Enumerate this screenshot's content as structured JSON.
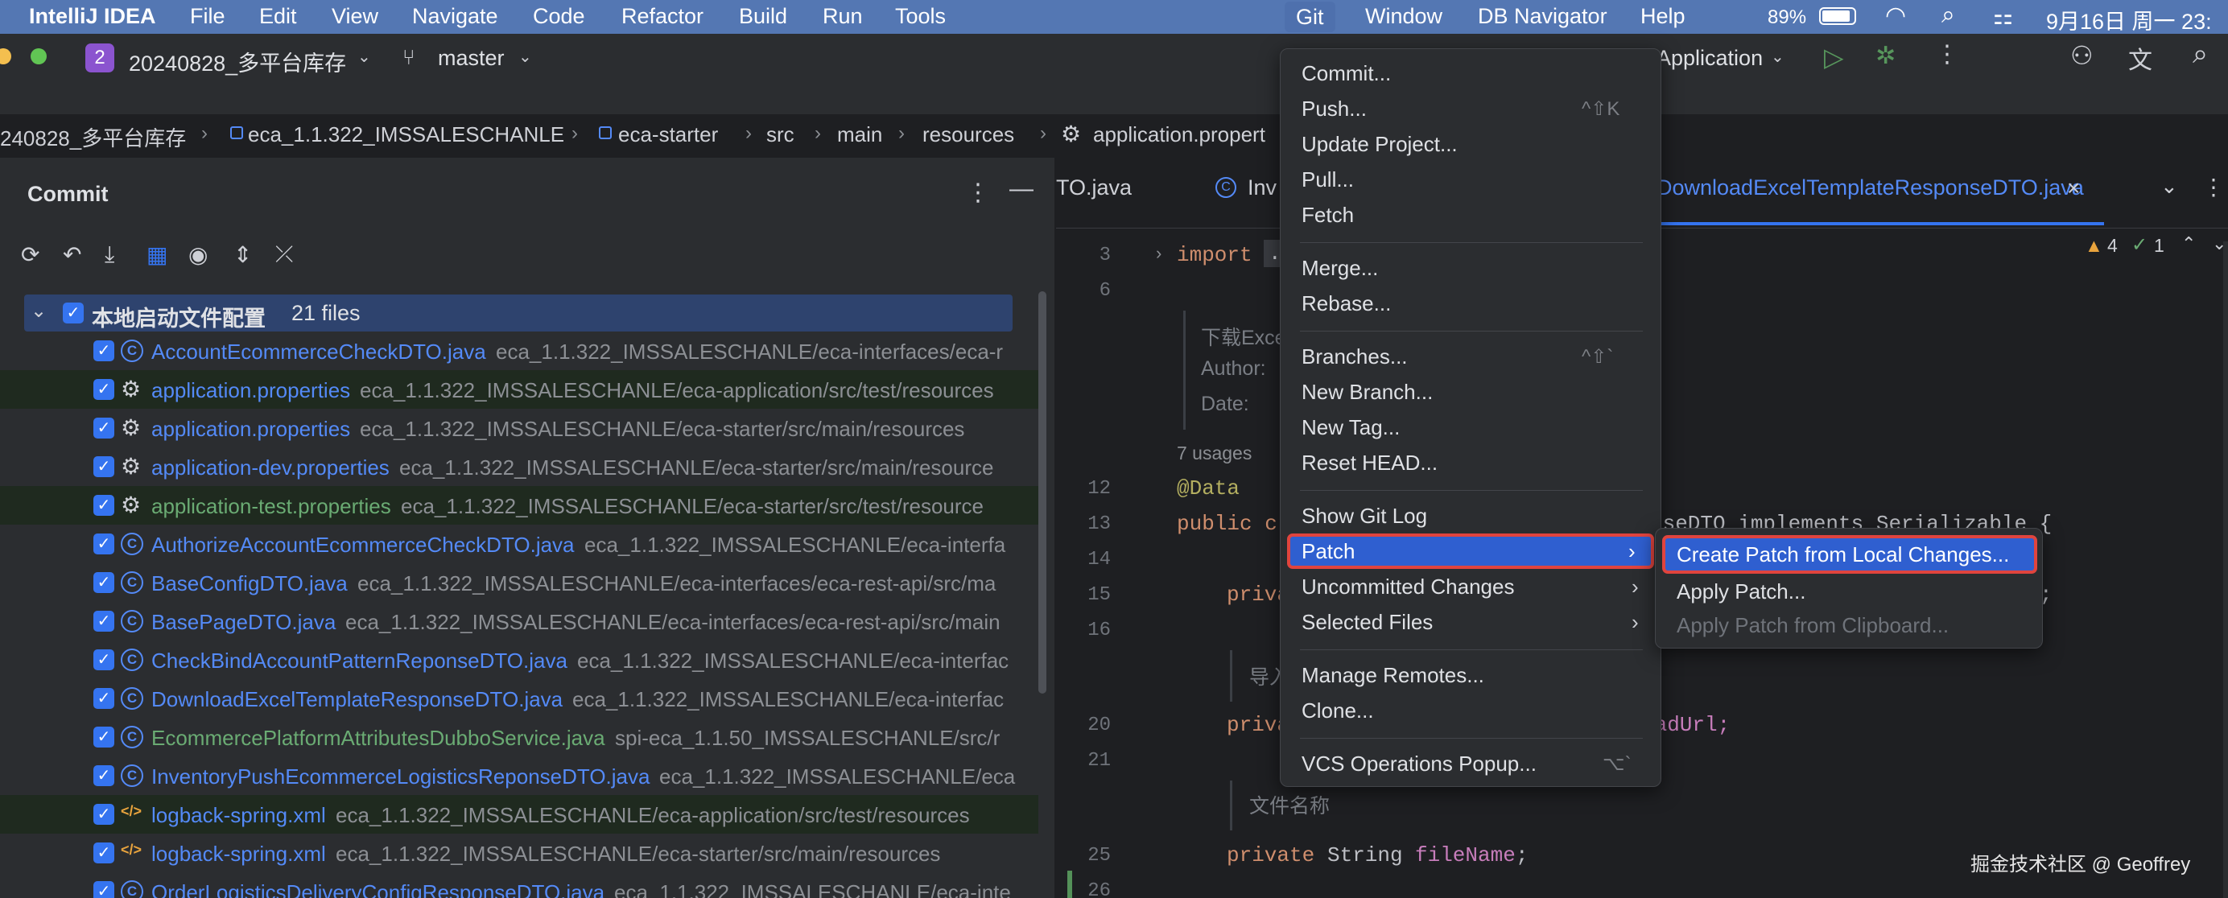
{
  "menubar": {
    "app": "IntelliJ IDEA",
    "items": [
      "File",
      "Edit",
      "View",
      "Navigate",
      "Code",
      "Refactor",
      "Build",
      "Run",
      "Tools",
      "Git",
      "Window",
      "DB Navigator",
      "Help"
    ],
    "battery": "89%",
    "datetime": "9月16日 周一 23:"
  },
  "toolbar": {
    "project_badge": "2",
    "project": "20240828_多平台库存",
    "branch": "master",
    "run_config": "Application"
  },
  "breadcrumb": [
    "240828_多平台库存",
    "eca_1.1.322_IMSSALESCHANLE",
    "eca-starter",
    "src",
    "main",
    "resources",
    "application.propert"
  ],
  "commit": {
    "title": "Commit",
    "group_label": "本地启动文件配置",
    "group_count": "21 files",
    "files": [
      {
        "name": "AccountEcommerceCheckDTO.java",
        "path": "eca_1.1.322_IMSSALESCHANLE/eca-interfaces/eca-r",
        "icon": "class",
        "color": "#548af7"
      },
      {
        "name": "application.properties",
        "path": "eca_1.1.322_IMSSALESCHANLE/eca-application/src/test/resources",
        "icon": "gear",
        "color": "#548af7",
        "bg": "#1f2a1f"
      },
      {
        "name": "application.properties",
        "path": "eca_1.1.322_IMSSALESCHANLE/eca-starter/src/main/resources",
        "icon": "gear",
        "color": "#548af7"
      },
      {
        "name": "application-dev.properties",
        "path": "eca_1.1.322_IMSSALESCHANLE/eca-starter/src/main/resource",
        "icon": "gear",
        "color": "#548af7"
      },
      {
        "name": "application-test.properties",
        "path": "eca_1.1.322_IMSSALESCHANLE/eca-starter/src/test/resource",
        "icon": "gear",
        "color": "#6aab73",
        "bg": "#1f2a1f"
      },
      {
        "name": "AuthorizeAccountEcommerceCheckDTO.java",
        "path": "eca_1.1.322_IMSSALESCHANLE/eca-interfa",
        "icon": "class",
        "color": "#548af7"
      },
      {
        "name": "BaseConfigDTO.java",
        "path": "eca_1.1.322_IMSSALESCHANLE/eca-interfaces/eca-rest-api/src/ma",
        "icon": "class",
        "color": "#548af7"
      },
      {
        "name": "BasePageDTO.java",
        "path": "eca_1.1.322_IMSSALESCHANLE/eca-interfaces/eca-rest-api/src/main",
        "icon": "class",
        "color": "#548af7"
      },
      {
        "name": "CheckBindAccountPatternReponseDTO.java",
        "path": "eca_1.1.322_IMSSALESCHANLE/eca-interfac",
        "icon": "class",
        "color": "#548af7"
      },
      {
        "name": "DownloadExcelTemplateResponseDTO.java",
        "path": "eca_1.1.322_IMSSALESCHANLE/eca-interfac",
        "icon": "class",
        "color": "#548af7"
      },
      {
        "name": "EcommercePlatformAttributesDubboService.java",
        "path": "spi-eca_1.1.50_IMSSALESCHANLE/src/r",
        "icon": "class",
        "color": "#6aab73"
      },
      {
        "name": "InventoryPushEcommerceLogisticsReponseDTO.java",
        "path": "eca_1.1.322_IMSSALESCHANLE/eca",
        "icon": "class",
        "color": "#548af7"
      },
      {
        "name": "logback-spring.xml",
        "path": "eca_1.1.322_IMSSALESCHANLE/eca-application/src/test/resources",
        "icon": "xml",
        "color": "#548af7",
        "bg": "#1f2a1f"
      },
      {
        "name": "logback-spring.xml",
        "path": "eca_1.1.322_IMSSALESCHANLE/eca-starter/src/main/resources",
        "icon": "xml",
        "color": "#548af7"
      },
      {
        "name": "OrderLogisticsDeliveryConfigResponseDTO.java",
        "path": "eca_1.1.322_IMSSALESCHANLE/eca-inte",
        "icon": "class",
        "color": "#548af7"
      }
    ]
  },
  "editor": {
    "tabs": [
      "TO.java",
      "Inv",
      "DownloadExcelTemplateResponseDTO.java"
    ],
    "warnings": "4",
    "checks": "1",
    "lines": {
      "l3": "3",
      "l6": "6",
      "l12": "12",
      "l13": "13",
      "l14": "14",
      "l15": "15",
      "l16": "16",
      "l20": "20",
      "l21": "21",
      "l25": "25",
      "l26": "26"
    },
    "import_kw": "import",
    "import_dots": ".",
    "doc1": "下载Exce",
    "doc2": "Author:",
    "doc3": "Date:",
    "usages": "7 usages",
    "annot": "@Data",
    "class_kw": "public c",
    "class_tail": "nseDTO implements Serializable {",
    "priv1": "priva",
    "priv1_tail": ";",
    "doc4": "导入",
    "priv2": "priva",
    "priv2_tail": "oadUrl;",
    "doc5": "文件名称",
    "priv3_kw": "private ",
    "priv3_type": "String ",
    "priv3_name": "fileName",
    "priv3_end": ";"
  },
  "git_menu": {
    "commit": "Commit...",
    "push": "Push...",
    "push_sc": "^⇧K",
    "update": "Update Project...",
    "pull": "Pull...",
    "fetch": "Fetch",
    "merge": "Merge...",
    "rebase": "Rebase...",
    "branches": "Branches...",
    "branches_sc": "^⇧`",
    "new_branch": "New Branch...",
    "new_tag": "New Tag...",
    "reset_head": "Reset HEAD...",
    "show_log": "Show Git Log",
    "patch": "Patch",
    "uncommitted": "Uncommitted Changes",
    "selected_files": "Selected Files",
    "manage_remotes": "Manage Remotes...",
    "clone": "Clone...",
    "vcs_popup": "VCS Operations Popup...",
    "vcs_sc": "⌥`"
  },
  "patch_menu": {
    "create": "Create Patch from Local Changes...",
    "apply": "Apply Patch...",
    "apply_clipboard": "Apply Patch from Clipboard..."
  },
  "watermark": "掘金技术社区 @ Geoffrey",
  "colors": {
    "menubar": "#5477b3",
    "selection": "#2f5fd0",
    "highlight_box": "#e0443e",
    "accent": "#3574f0"
  }
}
